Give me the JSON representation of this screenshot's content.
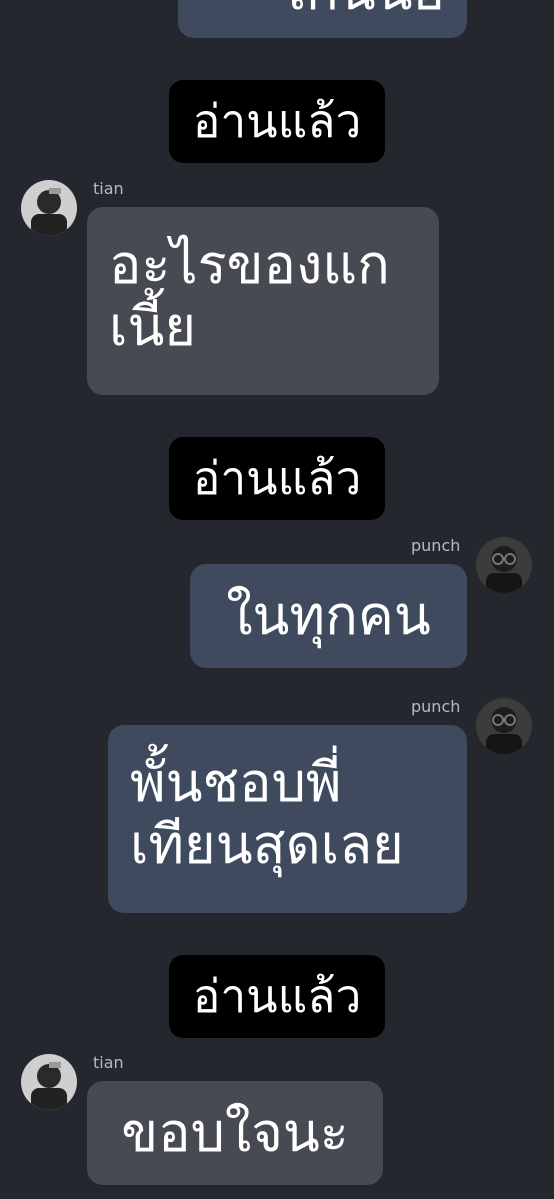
{
  "messages": [
    {
      "sender": "",
      "text": "เกินน้อ",
      "direction": "out"
    },
    {
      "read_label": "อ่านแล้ว"
    },
    {
      "sender": "tian",
      "text": "อะไรของแก\nเนี้ย",
      "direction": "in"
    },
    {
      "read_label": "อ่านแล้ว"
    },
    {
      "sender": "punch",
      "text": "ในทุกคน",
      "direction": "out"
    },
    {
      "sender": "punch",
      "text": "พั้นชอบพี่\nเทียนสุดเลย",
      "direction": "out"
    },
    {
      "read_label": "อ่านแล้ว"
    },
    {
      "sender": "tian",
      "text": "ขอบใจนะ",
      "direction": "in"
    }
  ],
  "colors": {
    "background": "#24272e",
    "incoming_bubble": "#474a53",
    "outgoing_bubble": "#404a5e",
    "read_tag": "#000000",
    "text": "#ffffff",
    "sender_name": "#b7bac2"
  },
  "icons": {
    "tian_avatar": "profile-photo",
    "punch_avatar": "profile-photo"
  }
}
